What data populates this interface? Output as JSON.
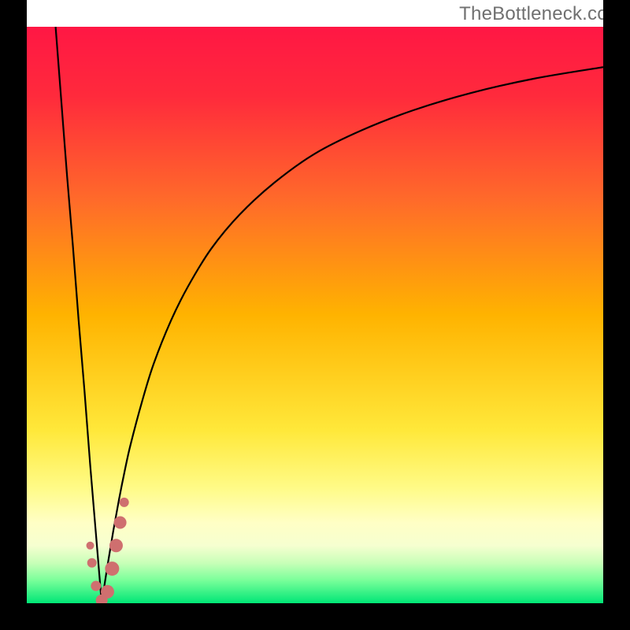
{
  "watermark": "TheBottleneck.com",
  "colors": {
    "frame": "#000000",
    "watermark": "#707070",
    "curve": "#000000",
    "marker_fill": "#cf6f6f",
    "marker_stroke": "#a84848",
    "gradient_stops": [
      {
        "offset": 0.0,
        "color": "#ff1744"
      },
      {
        "offset": 0.12,
        "color": "#ff2a3c"
      },
      {
        "offset": 0.3,
        "color": "#ff6a2a"
      },
      {
        "offset": 0.5,
        "color": "#ffb300"
      },
      {
        "offset": 0.7,
        "color": "#ffe83a"
      },
      {
        "offset": 0.8,
        "color": "#fffb87"
      },
      {
        "offset": 0.86,
        "color": "#ffffc5"
      },
      {
        "offset": 0.9,
        "color": "#f6ffd0"
      },
      {
        "offset": 0.93,
        "color": "#c8ffb8"
      },
      {
        "offset": 0.96,
        "color": "#7aff9a"
      },
      {
        "offset": 1.0,
        "color": "#00e676"
      }
    ]
  },
  "chart_data": {
    "type": "line",
    "title": "",
    "xlabel": "",
    "ylabel": "",
    "xlim": [
      0,
      100
    ],
    "ylim": [
      0,
      100
    ],
    "minimum_x": 13.0,
    "background": "heatmap-vertical-gradient",
    "series": [
      {
        "name": "left-branch",
        "x": [
          5.0,
          6.0,
          7.0,
          8.0,
          9.0,
          10.0,
          11.0,
          12.0,
          13.0
        ],
        "values": [
          100.0,
          87.0,
          74.0,
          62.0,
          49.0,
          37.0,
          24.0,
          12.0,
          0.0
        ]
      },
      {
        "name": "right-branch",
        "x": [
          13.0,
          14.0,
          15.0,
          16.0,
          17.0,
          18.0,
          20.0,
          22.0,
          25.0,
          28.0,
          32.0,
          37.0,
          43.0,
          50.0,
          58.0,
          67.0,
          77.0,
          88.0,
          100.0
        ],
        "values": [
          0.0,
          6.5,
          12.5,
          18.0,
          23.0,
          27.5,
          35.0,
          41.5,
          49.0,
          55.0,
          61.5,
          67.5,
          73.0,
          78.0,
          82.0,
          85.5,
          88.5,
          91.0,
          93.0
        ]
      }
    ],
    "markers": {
      "name": "highlighted-points",
      "color": "#cf6f6f",
      "points": [
        {
          "x": 11.0,
          "y": 10.0,
          "r": 5.0
        },
        {
          "x": 11.3,
          "y": 7.0,
          "r": 6.0
        },
        {
          "x": 12.0,
          "y": 3.0,
          "r": 6.5
        },
        {
          "x": 13.0,
          "y": 0.5,
          "r": 7.5
        },
        {
          "x": 14.0,
          "y": 2.0,
          "r": 8.5
        },
        {
          "x": 14.8,
          "y": 6.0,
          "r": 9.0
        },
        {
          "x": 15.5,
          "y": 10.0,
          "r": 8.5
        },
        {
          "x": 16.2,
          "y": 14.0,
          "r": 8.0
        },
        {
          "x": 16.9,
          "y": 17.5,
          "r": 6.0
        }
      ]
    }
  }
}
